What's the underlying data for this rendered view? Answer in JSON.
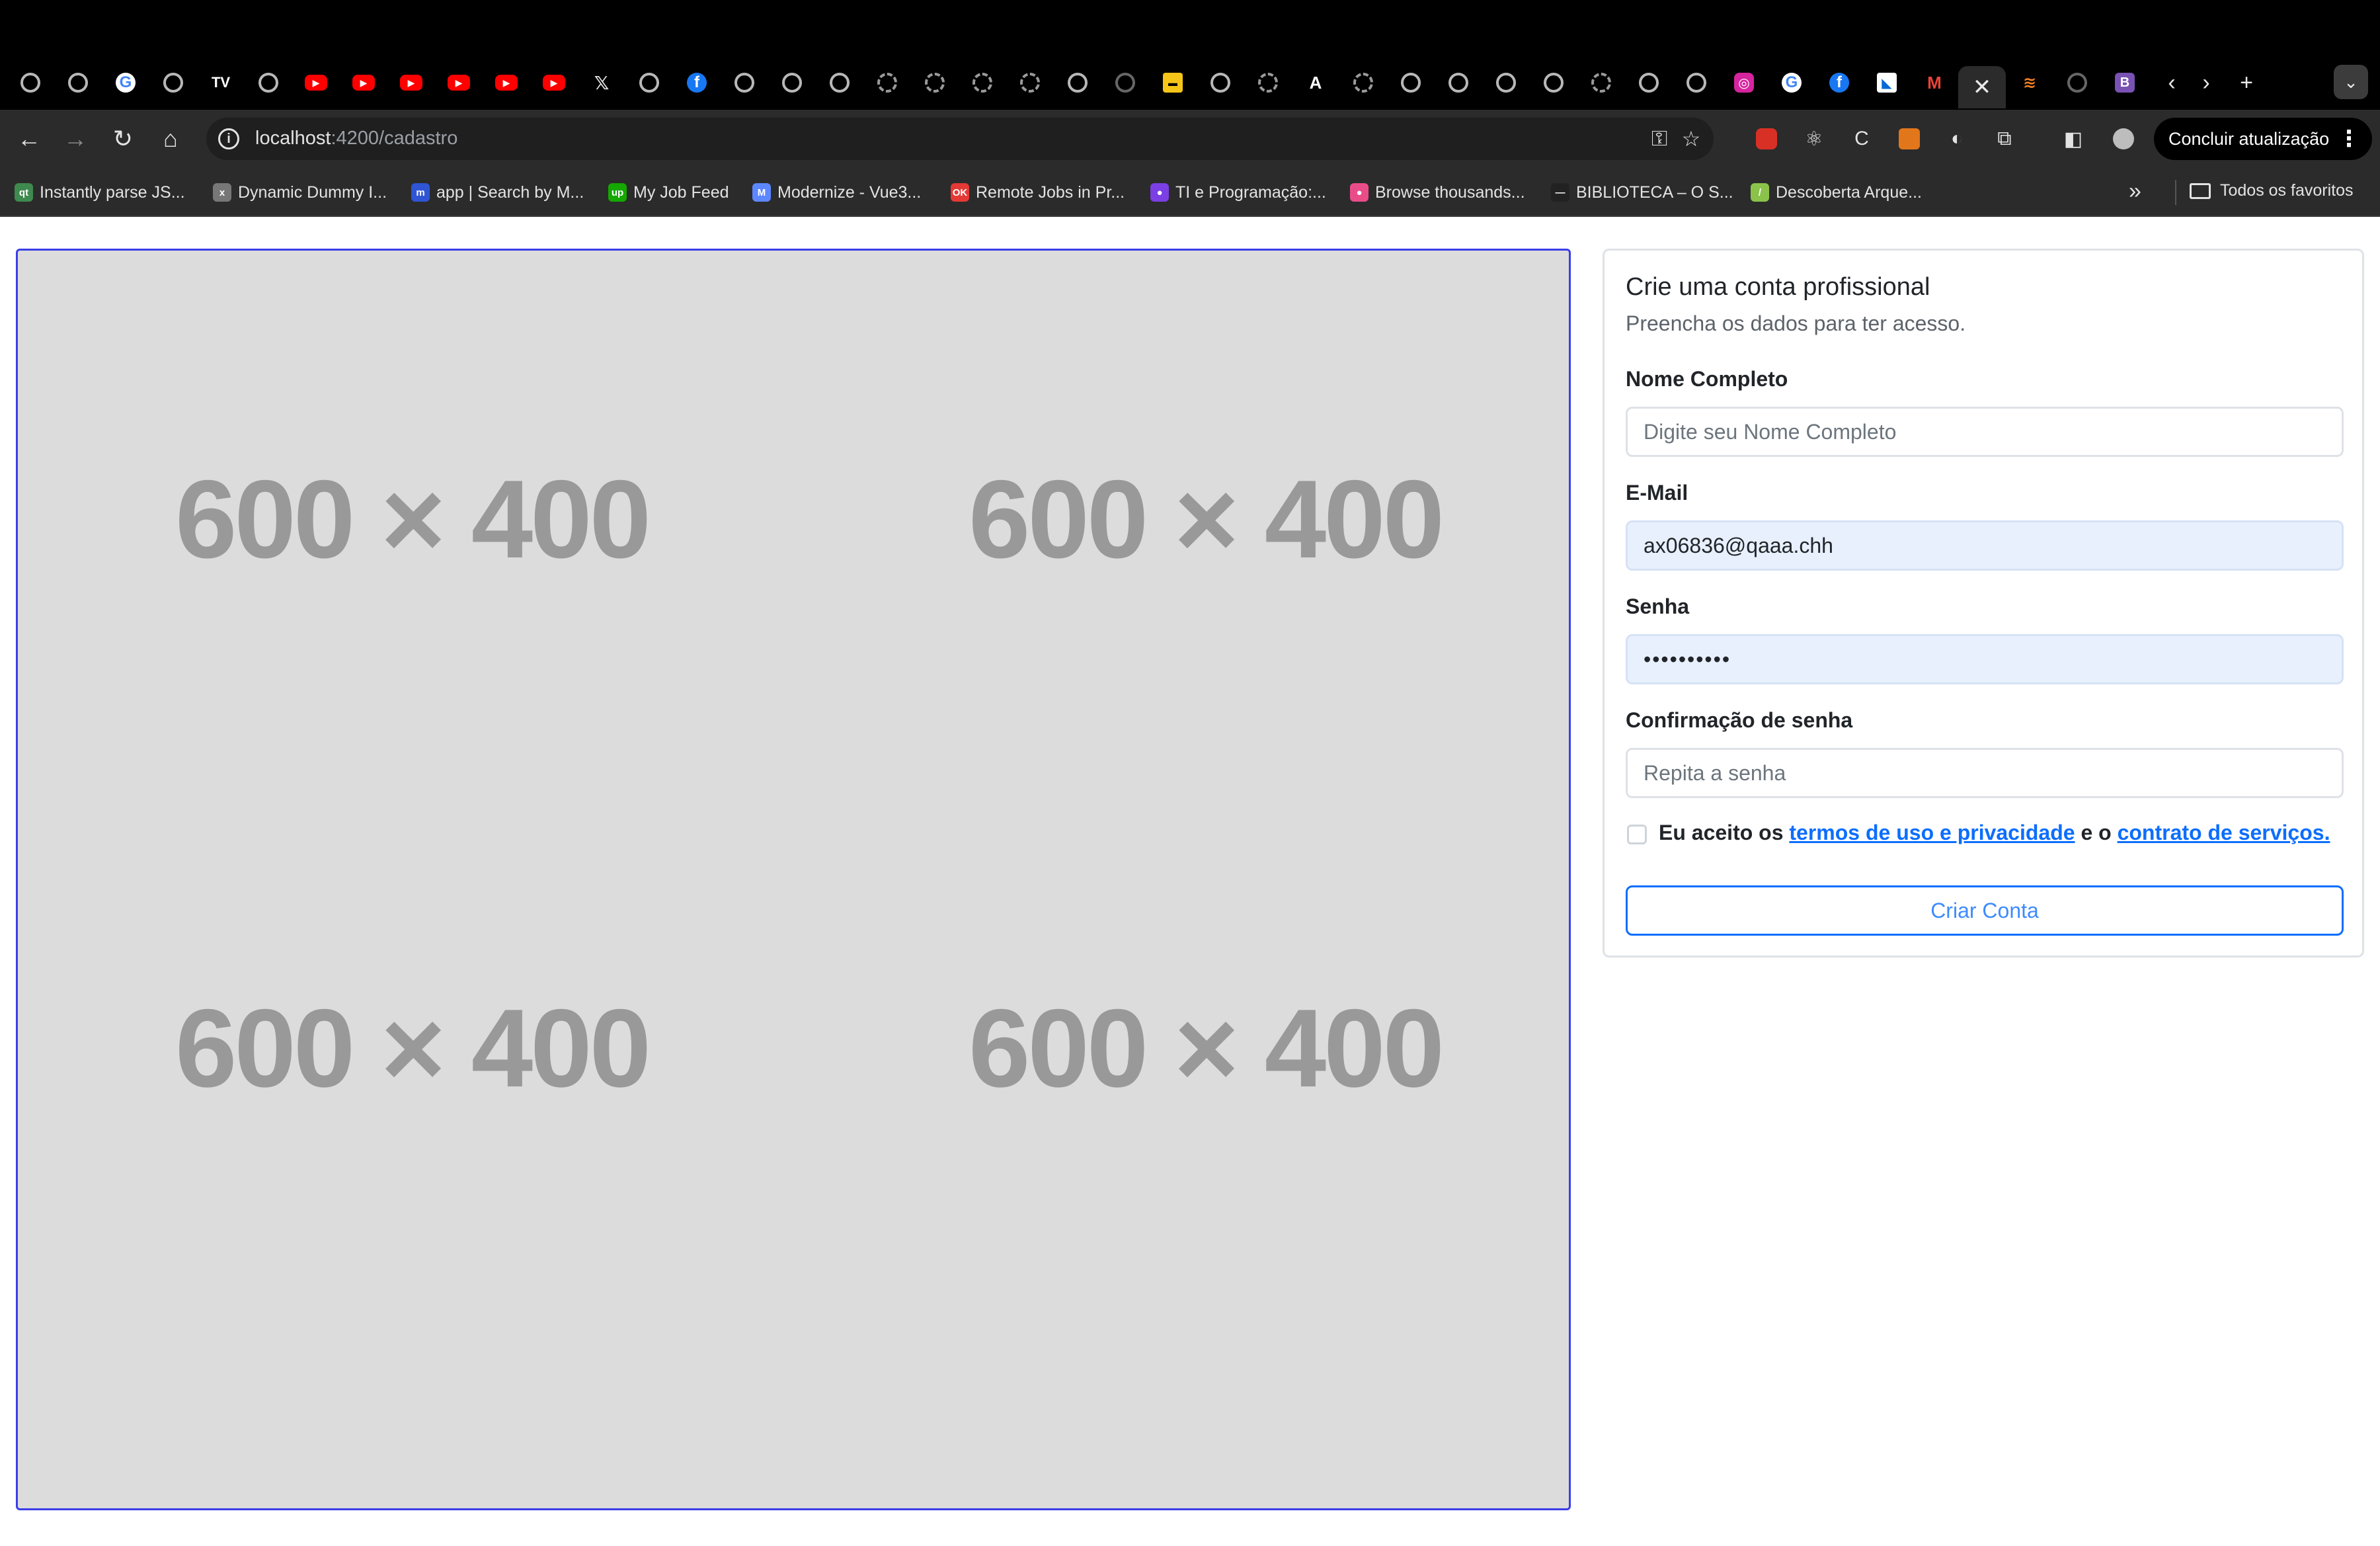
{
  "browser": {
    "tab_favicons": [
      "ring",
      "ring",
      "google",
      "ring",
      "tradingview",
      "ring",
      "youtube",
      "youtube",
      "youtube",
      "youtube",
      "youtube",
      "youtube",
      "x",
      "ring",
      "facebook",
      "ring",
      "ring",
      "ring",
      "ring-dash",
      "ring-dash",
      "ring-dash",
      "ring-dash",
      "ring",
      "github",
      "slides",
      "ring",
      "ring-dash",
      "a",
      "ring-dash",
      "ring",
      "ring",
      "ring",
      "ring",
      "ring-dash",
      "ring",
      "ring",
      "instagram",
      "google",
      "facebook",
      "flutter",
      "gmail"
    ],
    "active_tab_close": "✕",
    "url_host": "localhost",
    "url_rest": ":4200/cadastro",
    "update_button_label": "Concluir atualização",
    "bookmarks": [
      {
        "label": "Instantly parse JS...",
        "icon": "qt",
        "color": "#3f8a4e"
      },
      {
        "label": "Dynamic Dummy I...",
        "icon": "x",
        "color": "#777777"
      },
      {
        "label": "app | Search by M...",
        "icon": "m",
        "color": "#2f55d4"
      },
      {
        "label": "My Job Feed",
        "icon": "up",
        "color": "#14a800"
      },
      {
        "label": "Modernize - Vue3...",
        "icon": "M",
        "color": "#5d87ff"
      },
      {
        "label": "Remote Jobs in Pr...",
        "icon": "OK",
        "color": "#e53935"
      },
      {
        "label": "TI e Programação:...",
        "icon": "●",
        "color": "#7b3fe4"
      },
      {
        "label": "Browse thousands...",
        "icon": "●",
        "color": "#ea4c89"
      },
      {
        "label": "BIBLIOTECA – O S...",
        "icon": "—",
        "color": "#222222"
      },
      {
        "label": "Descoberta Arque...",
        "icon": "/",
        "color": "#8bc34a"
      }
    ],
    "all_bookmarks_label": "Todos os favoritos"
  },
  "carousel": {
    "placeholders": [
      "600 × 400",
      "600 × 400",
      "600 × 400",
      "600 × 400"
    ]
  },
  "form": {
    "title": "Crie uma conta profissional",
    "subtitle": "Preencha os dados para ter acesso.",
    "name_label": "Nome Completo",
    "name_placeholder": "Digite seu Nome Completo",
    "name_value": "",
    "email_label": "E-Mail",
    "email_value": "ax06836@qaaa.chh",
    "password_label": "Senha",
    "password_value": "••••••••••",
    "confirm_label": "Confirmação de senha",
    "confirm_placeholder": "Repita a senha",
    "terms_prefix": "Eu aceito os ",
    "terms_link": "termos de uso e privacidade",
    "terms_middle": " e o ",
    "contract_link": "contrato de serviços.",
    "terms_checked": false,
    "submit_label": "Criar Conta"
  },
  "colors": {
    "accent": "#0d6efd",
    "carousel_border": "#3b3ee8",
    "autofill_bg": "#e8f0fe"
  }
}
